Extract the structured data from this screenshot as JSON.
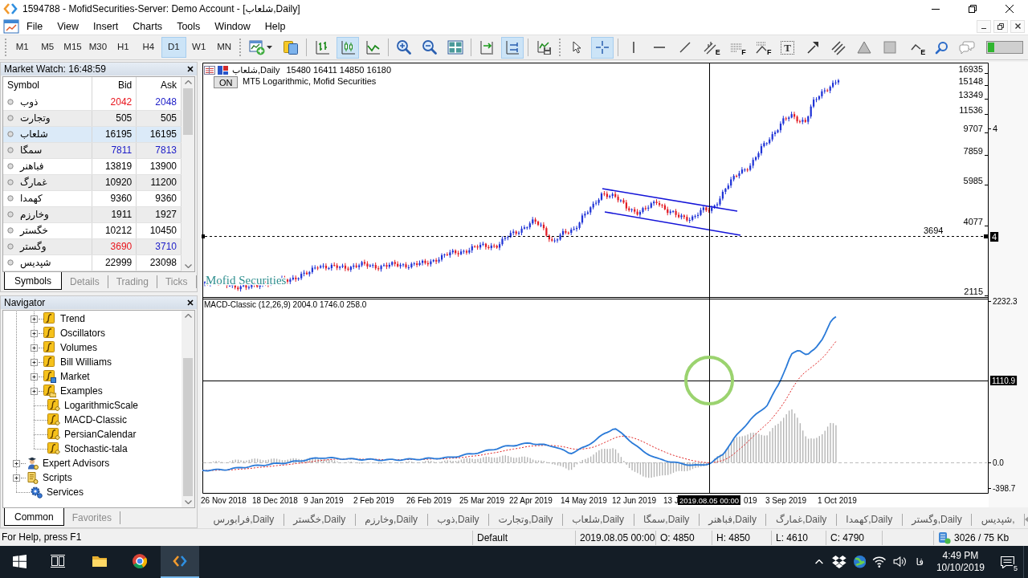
{
  "window": {
    "title": "1594788 - MofidSecurities-Server: Demo Account - [شلعاب,Daily]"
  },
  "menu": [
    "File",
    "View",
    "Insert",
    "Charts",
    "Tools",
    "Window",
    "Help"
  ],
  "timeframes": [
    {
      "label": "M1",
      "selected": false
    },
    {
      "label": "M5",
      "selected": false
    },
    {
      "label": "M15",
      "selected": false
    },
    {
      "label": "M30",
      "selected": false
    },
    {
      "label": "H1",
      "selected": false
    },
    {
      "label": "H4",
      "selected": false
    },
    {
      "label": "D1",
      "selected": true
    },
    {
      "label": "W1",
      "selected": false
    },
    {
      "label": "MN",
      "selected": false
    }
  ],
  "tool_groups": [
    [
      {
        "kind": "new-chart",
        "selected": false
      },
      {
        "kind": "profiles",
        "selected": false
      }
    ],
    [
      {
        "kind": "bar-chart",
        "selected": false
      },
      {
        "kind": "candlesticks",
        "selected": true
      },
      {
        "kind": "line-chart",
        "selected": false
      }
    ],
    [
      {
        "kind": "zoom-in",
        "selected": false
      },
      {
        "kind": "zoom-out",
        "selected": false
      },
      {
        "kind": "tile",
        "selected": false
      }
    ],
    [
      {
        "kind": "chart-shift",
        "selected": false
      },
      {
        "kind": "autoscroll",
        "selected": true
      }
    ],
    [
      {
        "kind": "templates",
        "selected": false
      }
    ],
    [
      {
        "kind": "cursor",
        "selected": false
      },
      {
        "kind": "crosshair",
        "selected": true
      }
    ],
    [
      {
        "kind": "vertical-line",
        "selected": false
      },
      {
        "kind": "horizontal-line",
        "selected": false
      },
      {
        "kind": "trendline",
        "selected": false
      },
      {
        "kind": "channel",
        "letter": "E",
        "selected": false
      },
      {
        "kind": "fibo-retracement",
        "letter": "F",
        "selected": false
      },
      {
        "kind": "fibo-fan",
        "letter": "F",
        "selected": false
      },
      {
        "kind": "text",
        "letter": "T",
        "selected": false
      },
      {
        "kind": "arrow",
        "selected": false
      },
      {
        "kind": "parallel-lines",
        "selected": false
      },
      {
        "kind": "triangle",
        "selected": false
      },
      {
        "kind": "rectangle",
        "selected": false
      },
      {
        "kind": "wave",
        "letter": "E",
        "selected": false
      }
    ],
    [
      {
        "kind": "search",
        "selected": false
      },
      {
        "kind": "chat",
        "selected": false
      }
    ]
  ],
  "market_watch": {
    "title": "Market Watch: 16:48:59",
    "columns": [
      "Symbol",
      "Bid",
      "Ask"
    ],
    "rows": [
      {
        "symbol": "ذوب",
        "bid": {
          "text": "2042",
          "color": "#e8141c"
        },
        "ask": {
          "text": "2048",
          "color": "#1c1cc8"
        },
        "selected": false
      },
      {
        "symbol": "وتجارت",
        "bid": {
          "text": "505",
          "color": "#000000"
        },
        "ask": {
          "text": "505",
          "color": "#000000"
        },
        "selected": false
      },
      {
        "symbol": "شلعاب",
        "bid": {
          "text": "16195",
          "color": "#000000"
        },
        "ask": {
          "text": "16195",
          "color": "#000000"
        },
        "selected": true
      },
      {
        "symbol": "سمگا",
        "bid": {
          "text": "7811",
          "color": "#1c1cc8"
        },
        "ask": {
          "text": "7813",
          "color": "#1c1cc8"
        },
        "selected": false
      },
      {
        "symbol": "فباهنر",
        "bid": {
          "text": "13819",
          "color": "#000000"
        },
        "ask": {
          "text": "13900",
          "color": "#000000"
        },
        "selected": false
      },
      {
        "symbol": "غمارگ",
        "bid": {
          "text": "10920",
          "color": "#000000"
        },
        "ask": {
          "text": "11200",
          "color": "#000000"
        },
        "selected": false
      },
      {
        "symbol": "کهمدا",
        "bid": {
          "text": "9360",
          "color": "#000000"
        },
        "ask": {
          "text": "9360",
          "color": "#000000"
        },
        "selected": false
      },
      {
        "symbol": "وخارزم",
        "bid": {
          "text": "1911",
          "color": "#000000"
        },
        "ask": {
          "text": "1927",
          "color": "#000000"
        },
        "selected": false
      },
      {
        "symbol": "خگستر",
        "bid": {
          "text": "10212",
          "color": "#000000"
        },
        "ask": {
          "text": "10450",
          "color": "#000000"
        },
        "selected": false
      },
      {
        "symbol": "وگستر",
        "bid": {
          "text": "3690",
          "color": "#e8141c"
        },
        "ask": {
          "text": "3710",
          "color": "#1c1cc8"
        },
        "selected": false
      },
      {
        "symbol": "شپدیس",
        "bid": {
          "text": "22999",
          "color": "#000000"
        },
        "ask": {
          "text": "23098",
          "color": "#000000"
        },
        "selected": false
      }
    ],
    "tabs": [
      {
        "label": "Symbols",
        "selected": true
      },
      {
        "label": "Details",
        "selected": false
      },
      {
        "label": "Trading",
        "selected": false
      },
      {
        "label": "Ticks",
        "selected": false
      }
    ]
  },
  "navigator": {
    "title": "Navigator",
    "tree": [
      {
        "children": [
          {
            "label": "Trend",
            "kind": "group",
            "expanded": false
          },
          {
            "label": "Oscillators",
            "kind": "group",
            "expanded": false
          },
          {
            "label": "Volumes",
            "kind": "group",
            "expanded": false
          },
          {
            "label": "Bill Williams",
            "kind": "group",
            "expanded": false
          },
          {
            "label": "Market",
            "kind": "market",
            "expanded": false
          },
          {
            "label": "Examples",
            "kind": "examples",
            "expanded": false
          },
          {
            "label": "LogarithmicScale",
            "kind": "indicator"
          },
          {
            "label": "MACD-Classic",
            "kind": "indicator"
          },
          {
            "label": "PersianCalendar",
            "kind": "indicator"
          },
          {
            "label": "Stochastic-tala",
            "kind": "indicator"
          }
        ]
      },
      {
        "label": "Expert Advisors",
        "kind": "experts",
        "expanded": false
      },
      {
        "label": "Scripts",
        "kind": "scripts",
        "expanded": false
      },
      {
        "label": "Services",
        "kind": "services"
      }
    ],
    "tabs": [
      {
        "label": "Common",
        "selected": true
      },
      {
        "label": "Favorites",
        "selected": false
      }
    ]
  },
  "chart": {
    "symbol": "شلعاب,Daily",
    "prices": "15480 16411 14850 16180",
    "toggle": "ON",
    "indicator_note": "MT5 Logarithmic, Mofid Securities",
    "logo": "Mofid Securities",
    "price_axis": [
      "16935",
      "15148",
      "13349",
      "11536",
      "9707",
      "7859",
      "5985",
      "4077",
      "2115"
    ],
    "price_marker": "4",
    "level_line": {
      "label": "3694",
      "tag": "4"
    },
    "macd": {
      "title": "MACD-Classic (12,26,9) 2004.0 1746.0 258.0",
      "axis": [
        "2232.3",
        "0.0",
        "-398.7"
      ]
    },
    "crosshair": {
      "value": "1110.9",
      "time": "2019.08.05 00:00"
    },
    "date_axis": [
      "26 Nov 2018",
      "18 Dec 2018",
      "9 Jan 2019",
      "2 Feb 2019",
      "26 Feb 2019",
      "25 Mar 2019",
      "22 Apr 2019",
      "14 May 2019",
      "12 Jun 2019",
      "13 J",
      "019",
      "3 Sep 2019",
      "1 Oct 2019"
    ]
  },
  "chart_tabs": [
    "فرابورس,Daily",
    "خگستر,Daily",
    "وخارزم,Daily",
    "ذوب,Daily",
    "وتجارت,Daily",
    "شلعاب,Daily",
    "سمگا,Daily",
    "فباهنر,Daily",
    "غمارگ,Daily",
    "کهمدا,Daily",
    "وگستر,Daily",
    "شپدیس,"
  ],
  "status_bar": {
    "help": "For Help, press F1",
    "profile": "Default",
    "time": "2019.08.05 00:00",
    "open": "O: 4850",
    "high": "H: 4850",
    "low": "L: 4610",
    "close": "C: 4790",
    "traffic": "3026 / 75 Kb"
  },
  "taskbar": {
    "apps": [
      {
        "kind": "explorer",
        "active": false
      },
      {
        "kind": "browser",
        "active": false
      },
      {
        "kind": "terminal",
        "active": true
      }
    ],
    "language": "فا",
    "time": "4:49 PM",
    "date": "10/10/2019",
    "notifications": "5"
  }
}
